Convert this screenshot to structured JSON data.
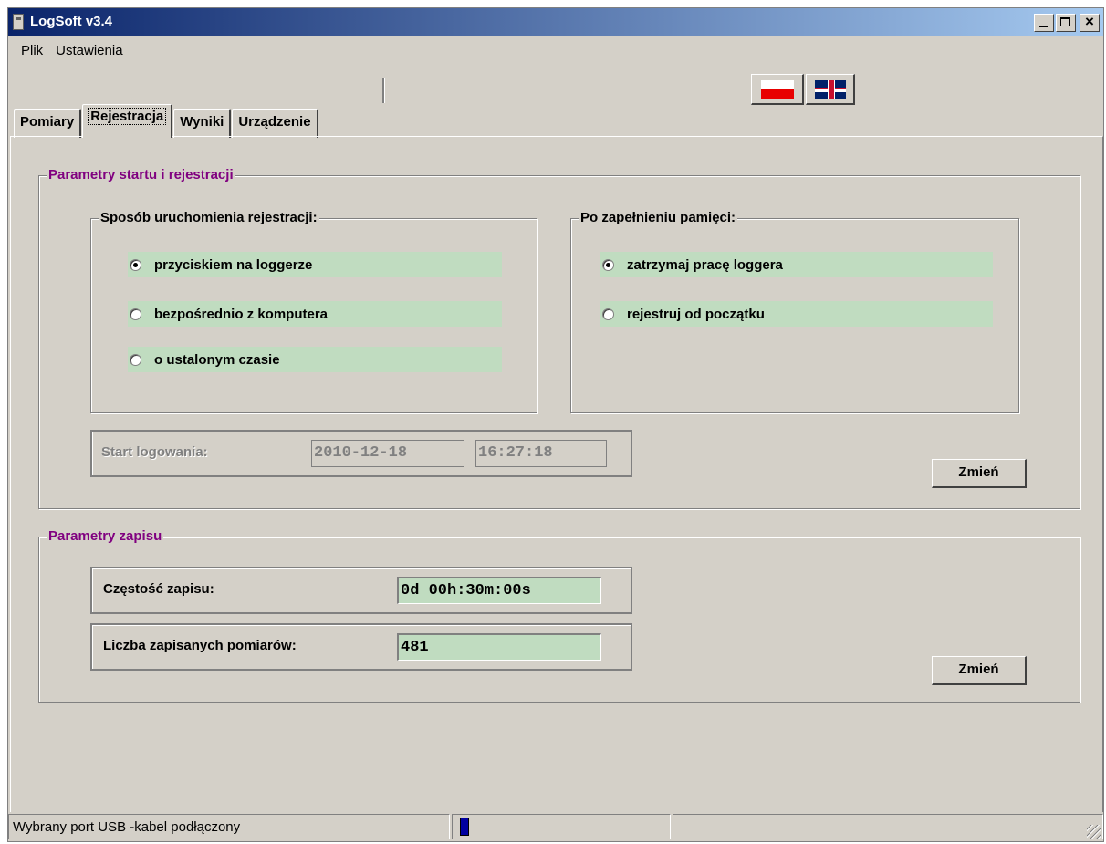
{
  "window": {
    "title": "LogSoft v3.4"
  },
  "menu": [
    "Plik",
    "Ustawienia"
  ],
  "tabs": [
    "Pomiary",
    "Rejestracja",
    "Wyniki",
    "Urządzenie"
  ],
  "active_tab": "Rejestracja",
  "group_start": {
    "title": "Parametry startu i rejestracji",
    "start_mode": {
      "title": "Sposób uruchomienia rejestracji:",
      "options": [
        "przyciskiem na loggerze",
        "bezpośrednio z komputera",
        "o ustalonym czasie"
      ],
      "selected": "przyciskiem na loggerze"
    },
    "memory_full": {
      "title": "Po zapełnieniu pamięci:",
      "options": [
        "zatrzymaj pracę loggera",
        "rejestruj od początku"
      ],
      "selected": "zatrzymaj pracę loggera"
    },
    "start_time": {
      "label": "Start logowania:",
      "date": "2010-12-18",
      "time": "16:27:18"
    },
    "change_button": "Zmień"
  },
  "group_save": {
    "title": "Parametry zapisu",
    "frequency": {
      "label": "Częstość zapisu:",
      "value": "0d  00h:30m:00s"
    },
    "count": {
      "label": "Liczba zapisanych pomiarów:",
      "value": "481"
    },
    "change_button": "Zmień"
  },
  "status": {
    "text": "Wybrany port USB  -kabel podłączony"
  },
  "icons": {
    "app": "app-icon",
    "minimize": "minimize-icon",
    "maximize": "maximize-icon",
    "close": "close-icon",
    "flag_pl": "polish-flag-icon",
    "flag_uk": "uk-flag-icon"
  },
  "colors": {
    "titlebar_start": "#0a246a",
    "titlebar_end": "#a6caf0",
    "group_title": "#800080",
    "field_green": "#c0dcc0"
  }
}
